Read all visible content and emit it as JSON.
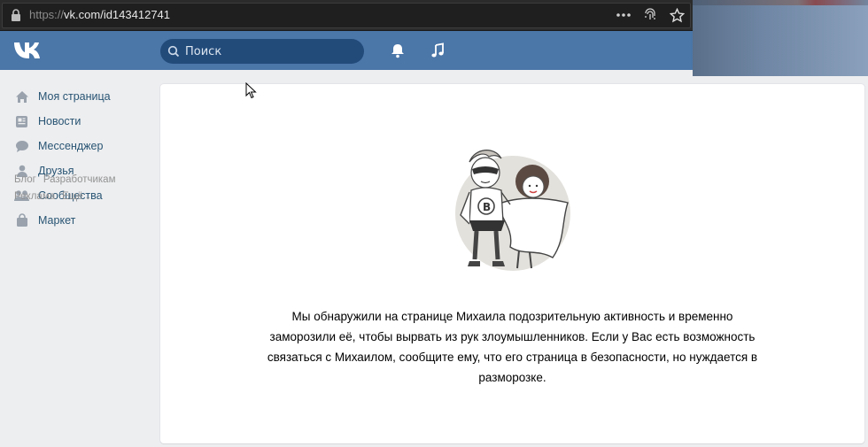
{
  "browser": {
    "url_scheme": "https://",
    "url_host": "vk.com",
    "url_path": "/id143412741"
  },
  "header": {
    "search_placeholder": "Поиск"
  },
  "sidebar": {
    "items": [
      {
        "label": "Моя страница",
        "icon": "home-icon"
      },
      {
        "label": "Новости",
        "icon": "news-icon"
      },
      {
        "label": "Мессенджер",
        "icon": "messenger-icon"
      },
      {
        "label": "Друзья",
        "icon": "friends-icon"
      },
      {
        "label": "Сообщества",
        "icon": "communities-icon"
      },
      {
        "label": "Маркет",
        "icon": "market-icon"
      }
    ],
    "footer_links": {
      "blog": "Блог",
      "developers": "Разработчикам",
      "ads": "Реклама",
      "more": "Ещё"
    }
  },
  "main": {
    "message": "Мы обнаружили на странице Михаила подозрительную активность и временно заморозили её, чтобы вырвать из рук злоумышленников. Если у Вас есть возможность связаться с Михаилом, сообщите ему, что его страница в безопасности, но нуждается в разморозке."
  },
  "colors": {
    "header_bg": "#4a76a8",
    "link": "#285473",
    "icon": "#99a2ad"
  }
}
